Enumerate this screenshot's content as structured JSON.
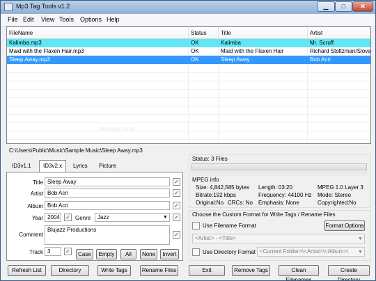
{
  "window": {
    "title": "Mp3 Tag Tools v1.2"
  },
  "menu": [
    "File",
    "Edit",
    "View",
    "Tools",
    "Options",
    "Help"
  ],
  "filelist": {
    "columns": [
      "FileName",
      "Status",
      "Title",
      "Artist"
    ],
    "rows": [
      {
        "filename": "Kalimba.mp3",
        "status": "OK",
        "title": "Kalimba",
        "artist": "Mr. Scruff"
      },
      {
        "filename": "Maid with the Flaxen Hair.mp3",
        "status": "OK",
        "title": "Maid with the Flaxen Hair",
        "artist": "Richard Stoltzman/Slovak"
      },
      {
        "filename": "Sleep Away.mp3",
        "status": "OK",
        "title": "Sleep Away",
        "artist": "Bob Acri"
      }
    ],
    "watermark": "Windows Snip"
  },
  "path": "C:\\Users\\Public\\Music\\Sample Music\\Sleep Away.mp3",
  "tabs": [
    "ID3v1.1",
    "ID3v2.x",
    "Lyrics",
    "Picture"
  ],
  "tag": {
    "title_label": "Title",
    "title": "Sleep Away",
    "artist_label": "Artist",
    "artist": "Bob Acri",
    "album_label": "Album",
    "album": "Bob Acri",
    "year_label": "Year",
    "year": "2004",
    "genre_label": "Genre",
    "genre": "Jazz",
    "comment_label": "Comment",
    "comment": "Blujazz Productions",
    "track_label": "Track",
    "track": "3",
    "buttons": [
      "Case",
      "Empty",
      "All",
      "None",
      "Invert"
    ]
  },
  "status": {
    "text": "Status: 3 Files"
  },
  "mpeg": {
    "heading": "MPEG info",
    "size": "Size: 4,842,585 bytes",
    "length": "Length: 03:20",
    "layer": "MPEG 1.0 Layer 3",
    "bitrate": "Bitrate:192 kbps",
    "frequency": "Frequency: 44100 Hz",
    "mode": "Mode: Stereo",
    "original": "Original:No",
    "crcs": "CRCs: No",
    "emphasis": "Emphasis: None",
    "copyrighted": "Copyrighted:No"
  },
  "format": {
    "heading": "Choose the Custom Format for Write Tags / Rename Files",
    "use_filename_label": "Use Filename Format",
    "format_options_button": "Format Options",
    "filename_format": "<Artist> - <Title>",
    "use_directory_label": "Use Directory Format",
    "directory_format": "<Current Folder>\\<Artist>\\<Album>\\"
  },
  "bottom_buttons": [
    "Refresh List",
    "Directory",
    "Write Tags",
    "Rename Files",
    "Exit",
    "Remove Tags",
    "Clean Filenames",
    "Create Directory"
  ]
}
